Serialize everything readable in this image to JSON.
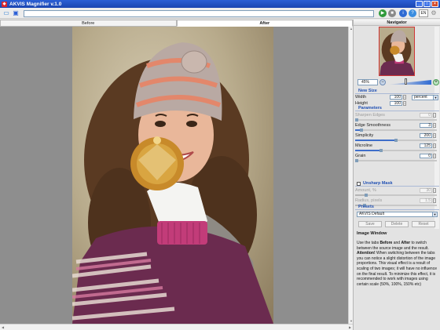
{
  "window": {
    "title": "AKVIS Magnifier v.1.0"
  },
  "toolbar": {
    "path": "",
    "lang": "EN"
  },
  "tabs": [
    {
      "label": "Before",
      "active": false
    },
    {
      "label": "After",
      "active": true
    }
  ],
  "navigator": {
    "title": "Navigator",
    "zoom": "45%"
  },
  "new_size": {
    "title": "New Size",
    "width_label": "Width",
    "width_value": "100",
    "height_label": "Height",
    "height_value": "100",
    "unit": "percent"
  },
  "parameters": {
    "title": "Parameters",
    "items": [
      {
        "label": "Sharpen Edges",
        "value": "0",
        "enabled": false,
        "level": 0
      },
      {
        "label": "Edge Smoothness",
        "value": "3",
        "enabled": true,
        "level": 0.06
      },
      {
        "label": "Simplicity",
        "value": "200",
        "enabled": true,
        "level": 0.5
      },
      {
        "label": "Microline",
        "value": "125",
        "enabled": true,
        "level": 0.31
      },
      {
        "label": "Grain",
        "value": "0",
        "enabled": true,
        "level": 0
      }
    ]
  },
  "unsharp": {
    "title": "Unsharp Mask",
    "items": [
      {
        "label": "Amount, %",
        "value": "30",
        "level": 0.12
      },
      {
        "label": "Radius, pixels",
        "value": "1.5",
        "level": 0.1
      }
    ]
  },
  "presets": {
    "title": "Presets",
    "selected": "AKVIS Default",
    "save_label": "Save",
    "delete_label": "Delete",
    "reset_label": "Reset"
  },
  "help": {
    "title": "Image Window",
    "p1": "Use the tabs",
    "before": "Before",
    "and": "and",
    "after": "After",
    "p2": "to switch between the source image and the result.",
    "attention": "Attention!",
    "p3": "When switching between the tabs you can notice a slight distortion of the image proportions. This visual effect is a result of scaling of two images; it will have no influence on the final result. To minimize this effect, it is recommended to work with images using certain scale (50%, 100%, 150% etc)"
  },
  "colors": {
    "title_bar": "#1b45b0",
    "group_heading": "#1f4fb3",
    "accent_slider": "#2f6bd3"
  }
}
